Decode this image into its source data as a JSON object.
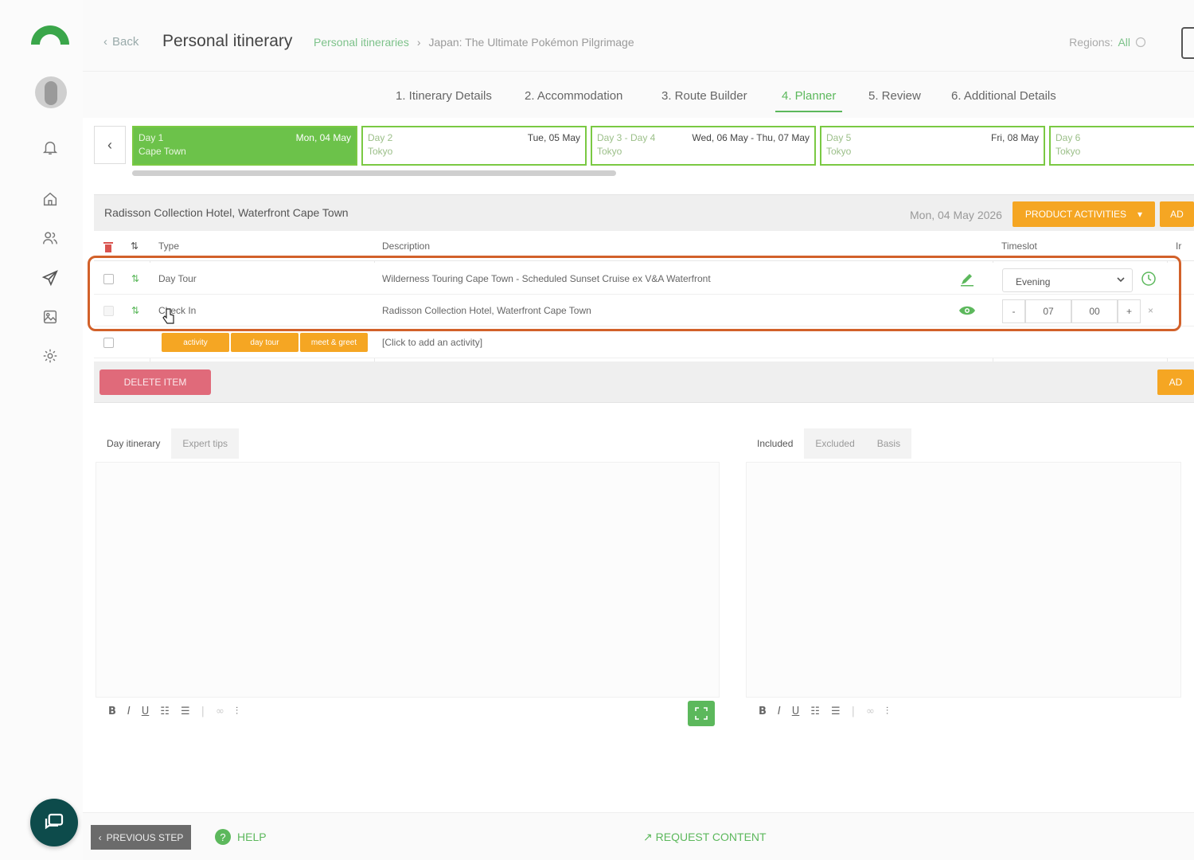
{
  "colors": {
    "accent_green": "#5cb85c",
    "orange": "#f5a623",
    "highlight": "#d2612a",
    "danger": "#e06a7a"
  },
  "header": {
    "back_label": "Back",
    "title": "Personal itinerary",
    "breadcrumb_link": "Personal itineraries",
    "breadcrumb_sep": "›",
    "breadcrumb_current": "Japan: The Ultimate Pokémon Pilgrimage",
    "regions_label": "Regions:",
    "regions_value": "All"
  },
  "steps": [
    {
      "label": "1. Itinerary Details"
    },
    {
      "label": "2. Accommodation"
    },
    {
      "label": "3. Route Builder"
    },
    {
      "label": "4. Planner"
    },
    {
      "label": "5. Review"
    },
    {
      "label": "6. Additional Details"
    }
  ],
  "days": [
    {
      "name": "Day 1",
      "date": "Mon, 04 May",
      "city": "Cape Town"
    },
    {
      "name": "Day 2",
      "date": "Tue, 05 May",
      "city": "Tokyo"
    },
    {
      "name": "Day 3 - Day 4",
      "date": "Wed, 06 May - Thu, 07 May",
      "city": "Tokyo"
    },
    {
      "name": "Day 5",
      "date": "Fri, 08 May",
      "city": "Tokyo"
    },
    {
      "name": "Day 6",
      "date": "",
      "city": "Tokyo"
    }
  ],
  "panel": {
    "hotel": "Radisson Collection Hotel, Waterfront Cape Town",
    "date": "Mon, 04 May 2026",
    "product_activities_label": "PRODUCT ACTIVITIES",
    "add_label": "AD",
    "delete_label": "DELETE ITEM",
    "add_bottom_label": "AD"
  },
  "table": {
    "headers": {
      "type": "Type",
      "description": "Description",
      "timeslot": "Timeslot",
      "extra": "Ir"
    },
    "rows": [
      {
        "type": "Day Tour",
        "description": "Wilderness Touring Cape Town - Scheduled Sunset Cruise ex V&A Waterfront",
        "timeslot": "Evening"
      },
      {
        "type": "Check In",
        "description": "Radisson Collection Hotel, Waterfront Cape Town",
        "hour": "07",
        "minute": "00",
        "minus": "-",
        "plus": "+"
      }
    ],
    "chips": [
      "activity",
      "day tour",
      "meet & greet"
    ],
    "add_placeholder": "[Click to add an activity]"
  },
  "left_tabs": [
    {
      "label": "Day itinerary"
    },
    {
      "label": "Expert tips"
    }
  ],
  "right_tabs": [
    {
      "label": "Included"
    },
    {
      "label": "Excluded"
    },
    {
      "label": "Basis"
    }
  ],
  "toolbar": {
    "bold": "B",
    "italic": "I",
    "underline": "U"
  },
  "bottom": {
    "previous_label": "PREVIOUS STEP",
    "help_label": "HELP",
    "request_label": "↗ REQUEST CONTENT"
  }
}
